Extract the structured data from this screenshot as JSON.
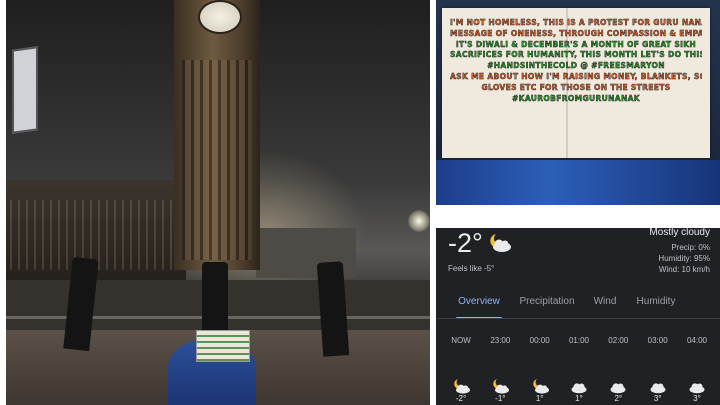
{
  "sign": {
    "lines": [
      {
        "text": "I'm not homeless, this is a protest for Guru Nanak's",
        "color": "orange"
      },
      {
        "text": "message of oneness, through compassion & empathy",
        "color": "orange"
      },
      {
        "text": "It's Diwali & December's a month of great Sikh",
        "color": "green"
      },
      {
        "text": "sacrifices for humanity, this month let's do this",
        "color": "green"
      },
      {
        "text": "#Handsinthecold @ #freesmaryon",
        "color": "green"
      },
      {
        "text": "Ask me about how I'm raising money, blankets, socks,",
        "color": "orange"
      },
      {
        "text": "gloves etc for those on the streets",
        "color": "orange"
      },
      {
        "text": "#Kaurobfromgurunanak",
        "color": "green"
      }
    ]
  },
  "weather": {
    "temperature": "-2°",
    "feels_like": "Feels like -5°",
    "condition": "Mostly cloudy",
    "precip": "Precip: 0%",
    "humidity": "Humidity: 95%",
    "wind": "Wind: 10 km/h",
    "tabs": [
      "Overview",
      "Precipitation",
      "Wind",
      "Humidity"
    ],
    "active_tab": "Overview",
    "hourly": [
      {
        "time": "NOW",
        "icon": "moon-cloud-icon",
        "temp": "-2°"
      },
      {
        "time": "23:00",
        "icon": "moon-cloud-icon",
        "temp": "-1°"
      },
      {
        "time": "00:00",
        "icon": "moon-cloud-icon",
        "temp": "1°"
      },
      {
        "time": "01:00",
        "icon": "cloud-icon",
        "temp": "1°"
      },
      {
        "time": "02:00",
        "icon": "cloud-icon",
        "temp": "2°"
      },
      {
        "time": "03:00",
        "icon": "cloud-icon",
        "temp": "3°"
      },
      {
        "time": "04:00",
        "icon": "cloud-icon",
        "temp": "3°"
      }
    ],
    "colors": {
      "background": "#202124",
      "accent": "#8ab4f8",
      "text": "#e8eaed",
      "muted": "#bdc1c6"
    }
  }
}
